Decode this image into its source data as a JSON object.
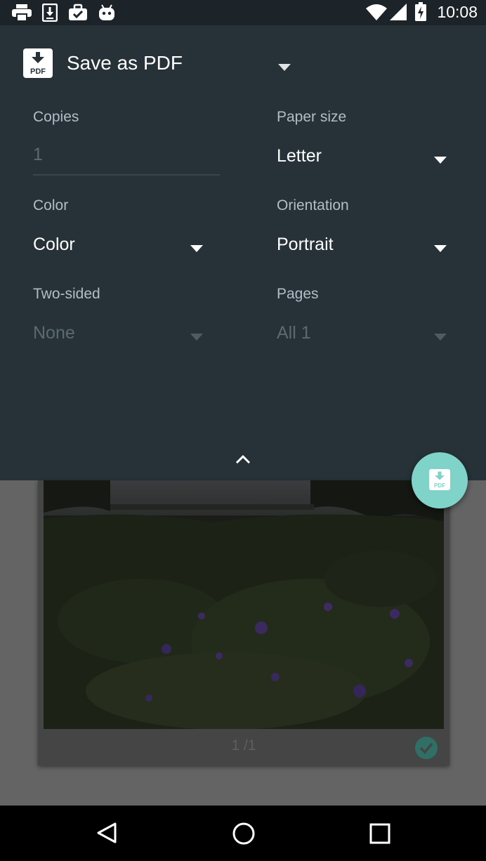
{
  "status_bar": {
    "time": "10:08",
    "icons": [
      "print-icon",
      "download-icon",
      "briefcase-check-icon",
      "android-icon",
      "wifi-icon",
      "signal-icon",
      "battery-charging-icon"
    ]
  },
  "destination": {
    "label": "Save as PDF",
    "icon": "pdf-download-icon"
  },
  "options": {
    "copies": {
      "label": "Copies",
      "value": "",
      "placeholder": "1"
    },
    "paper_size": {
      "label": "Paper size",
      "value": "Letter"
    },
    "color": {
      "label": "Color",
      "value": "Color"
    },
    "orientation": {
      "label": "Orientation",
      "value": "Portrait"
    },
    "two_sided": {
      "label": "Two-sided",
      "value": "None"
    },
    "pages": {
      "label": "Pages",
      "value": "All 1"
    }
  },
  "preview": {
    "page_counter": "1 /1",
    "selected": true
  },
  "fab": {
    "icon": "pdf-download-icon"
  },
  "nav": {
    "buttons": [
      "back-icon",
      "home-icon",
      "recents-icon"
    ]
  },
  "colors": {
    "panel": "#263238",
    "status_bar": "#1c2429",
    "fab": "#7fd3c9",
    "label": "#b0bec5",
    "disabled": "#5b6a71",
    "accent_check": "#3d8f82"
  }
}
